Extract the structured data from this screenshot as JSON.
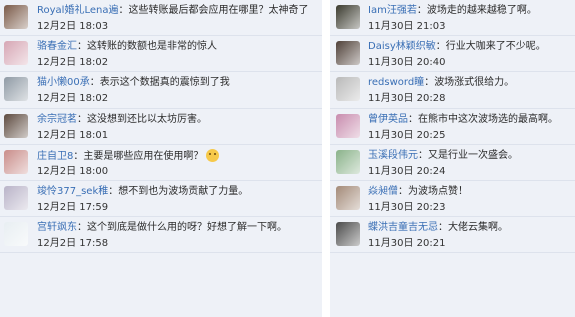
{
  "left_comments": [
    {
      "user": "Royal婚礼Lena遍",
      "sep": "：",
      "text": "这些转账最后都会应用在哪里？太神奇了",
      "time": "12月2日 18:03",
      "avatar_color": "#7a5a48",
      "avatar_icon": "profile-photo-icon"
    },
    {
      "user": "骆春金汇",
      "sep": "：",
      "text": "这转账的数额也是非常的惊人",
      "time": "12月2日 18:02",
      "avatar_color": "#d6a6b4",
      "avatar_icon": "profile-photo-icon"
    },
    {
      "user": "猫小懒00承",
      "sep": "：",
      "text": "表示这个数据真的震惊到了我",
      "time": "12月2日 18:02",
      "avatar_color": "#8f9aa5",
      "avatar_icon": "profile-photo-icon"
    },
    {
      "user": "余宗冠茗",
      "sep": "：",
      "text": "这没想到还比以太坊厉害。",
      "time": "12月2日 18:01",
      "avatar_color": "#5d4a3f",
      "avatar_icon": "profile-photo-icon"
    },
    {
      "user": "庄自卫8",
      "sep": "：",
      "text": "主要是哪些应用在使用啊？",
      "time": "12月2日 18:00",
      "avatar_color": "#c98d8a",
      "avatar_icon": "profile-photo-icon",
      "emoji": "smiley-emoji-icon"
    },
    {
      "user": "竣怜377_sek稚",
      "sep": "：",
      "text": "想不到也为波场贡献了力量。",
      "time": "12月2日 17:59",
      "avatar_color": "#b9b3c8",
      "avatar_icon": "profile-photo-icon"
    },
    {
      "user": "宫轩飒东",
      "sep": "：",
      "text": "这个到底是做什么用的呀？好想了解一下啊。",
      "time": "12月2日 17:58",
      "avatar_color": "#e8eef2",
      "avatar_icon": "profile-photo-icon"
    }
  ],
  "right_comments": [
    {
      "user": "Iam汪强若",
      "sep": "：",
      "text": "波场走的越来越稳了啊。",
      "time": "11月30日 21:03",
      "avatar_color": "#3a3a2e",
      "avatar_icon": "profile-photo-icon"
    },
    {
      "user": "Daisy林颖织敏",
      "sep": "：",
      "text": "行业大咖来了不少呢。",
      "time": "11月30日 20:40",
      "avatar_color": "#4f4038",
      "avatar_icon": "profile-photo-icon"
    },
    {
      "user": "redsword瞳",
      "sep": "：",
      "text": "波场涨式很给力。",
      "time": "11月30日 20:28",
      "avatar_color": "#b9b9b9",
      "avatar_icon": "profile-photo-icon"
    },
    {
      "user": "曾伊英品",
      "sep": "：",
      "text": "在熊市中这次波场选的最高啊。",
      "time": "11月30日 20:25",
      "avatar_color": "#c88cae",
      "avatar_icon": "profile-photo-icon"
    },
    {
      "user": "玉溪段伟元",
      "sep": "：",
      "text": "又是行业一次盛会。",
      "time": "11月30日 20:24",
      "avatar_color": "#8ab28a",
      "avatar_icon": "profile-photo-icon"
    },
    {
      "user": "焱昶僧",
      "sep": "：",
      "text": "为波场点赞！",
      "time": "11月30日 20:23",
      "avatar_color": "#a38a78",
      "avatar_icon": "profile-photo-icon"
    },
    {
      "user": "蝶洪吉童吉无忌",
      "sep": "：",
      "text": "大佬云集啊。",
      "time": "11月30日 20:21",
      "avatar_color": "#4a4a4a",
      "avatar_icon": "profile-photo-icon"
    }
  ]
}
